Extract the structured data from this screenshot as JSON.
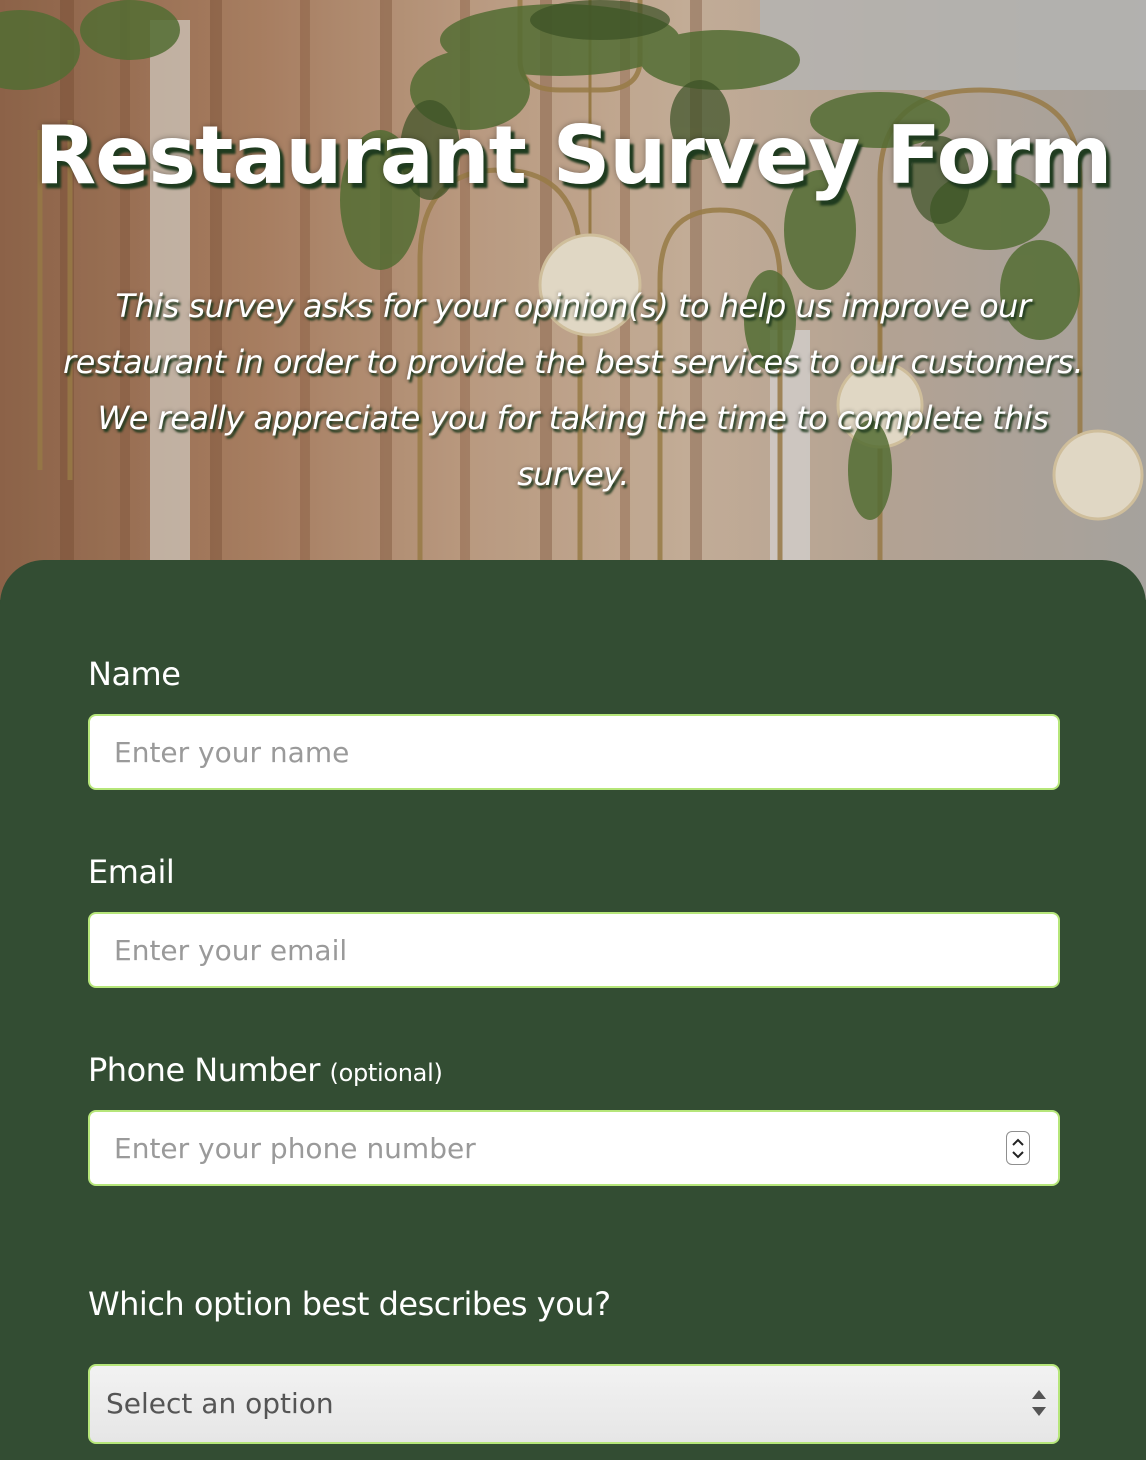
{
  "hero": {
    "title": "Restaurant Survey Form",
    "description": "This survey asks for your opinion(s) to help us improve our restaurant in order to provide the best services to our customers. We really appreciate you for taking the time to complete this survey."
  },
  "form": {
    "name": {
      "label": "Name",
      "placeholder": "Enter your name"
    },
    "email": {
      "label": "Email",
      "placeholder": "Enter your email"
    },
    "phone": {
      "label": "Phone Number",
      "optional_note": "(optional)",
      "placeholder": "Enter your phone number"
    },
    "role": {
      "question": "Which option best describes you?",
      "selected": "Select an option"
    }
  },
  "colors": {
    "form_background": "#334d33",
    "input_border": "#b6e67a",
    "title_shadow": "#1f3b1f"
  }
}
